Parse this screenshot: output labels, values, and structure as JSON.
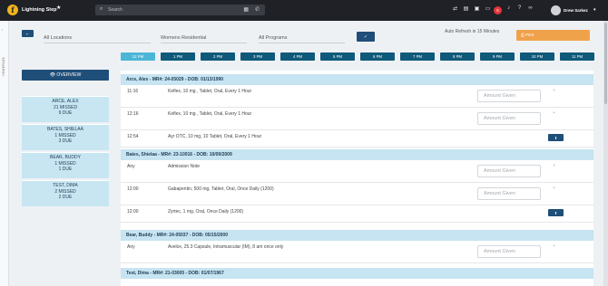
{
  "app": {
    "logo_letter": "f",
    "name": "Lightning Step"
  },
  "search": {
    "placeholder": "Search"
  },
  "header": {
    "notification_count": "5",
    "user_name": "Drew Sarkez"
  },
  "leftnav": {
    "label": "HOMEPAGE"
  },
  "filters": {
    "location": "All Locations",
    "residential": "Womens Residential",
    "program": "All Programs",
    "apply_icon": "✓"
  },
  "auto_refresh": "Auto Refresh in 15 Minutes",
  "print_label": "⎙ Print",
  "time_slots": [
    "12 PM",
    "1 PM",
    "2 PM",
    "3 PM",
    "4 PM",
    "5 PM",
    "6 PM",
    "7 PM",
    "8 PM",
    "9 PM",
    "10 PM",
    "11 PM"
  ],
  "overview_label": "👁 OVERVIEW",
  "patient_cards": [
    {
      "name": "ARCE, ALEX",
      "missed": "21 MISSED",
      "due": "9 DUE"
    },
    {
      "name": "BATES, SHIELAA",
      "missed": "1 MISSED",
      "due": "3 DUE"
    },
    {
      "name": "BEAR, BUDDY",
      "missed": "1 MISSED",
      "due": "1 DUE"
    },
    {
      "name": "TEST, DIMA",
      "missed": "2 MISSED",
      "due": "2 DUE"
    }
  ],
  "amount_placeholder": "Amount Given",
  "patients": [
    {
      "header": "Arce, Alex  -  MR#: 24-05029  -  DOB: 01/13/1990",
      "meds": [
        {
          "time": "11:16",
          "desc": "Keflex, 10 mg , Tablet, Oral, Every 1 Hour"
        },
        {
          "time": "12:16",
          "desc": "Keflex, 10 mg , Tablet, Oral, Every 1 Hour"
        },
        {
          "time": "12:54",
          "desc": "Ayr OTC, 10 mg, 10 Tablet, Oral, Every 1 Hour"
        }
      ]
    },
    {
      "header": "Bates, Shielaa  -  MR#: 23-10016  -  DOB: 10/09/2009",
      "meds": [
        {
          "time": "Any",
          "desc": "Admission Note"
        },
        {
          "time": "12:00",
          "desc": "Gabapentin, 500 mg, Tablet, Oral, Once Daily (1200)"
        },
        {
          "time": "12:00",
          "desc": "Zyrtec, 1 mg, Oral, Once Daily (1200)"
        }
      ]
    },
    {
      "header": "Bear, Buddy  -  MR#: 24-05037  -  DOB: 05/15/2000",
      "meds": [
        {
          "time": "Any",
          "desc": "Avelox, 25.3 Capsule, Intramuscular (IM), 8 am once only"
        }
      ]
    },
    {
      "header": "Test, Dima  -  MR#: 21-03005  -  DOB: 01/07/1967",
      "meds": []
    }
  ]
}
